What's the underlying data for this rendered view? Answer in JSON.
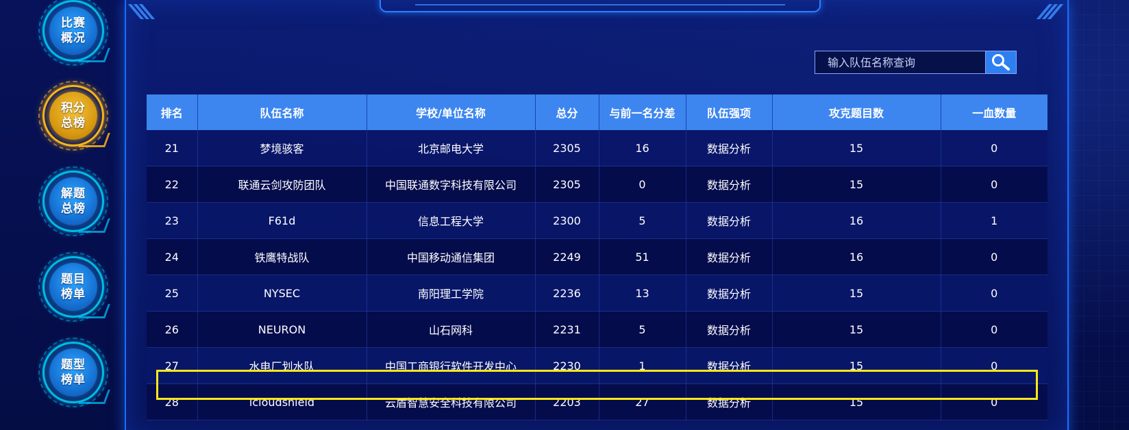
{
  "sidebar": {
    "items": [
      {
        "label": "比赛概况",
        "active": false
      },
      {
        "label": "积分总榜",
        "active": true
      },
      {
        "label": "解题总榜",
        "active": false
      },
      {
        "label": "题目榜单",
        "active": false
      },
      {
        "label": "题型榜单",
        "active": false
      }
    ]
  },
  "search": {
    "placeholder": "输入队伍名称查询",
    "value": "",
    "button_icon": "search-icon"
  },
  "table": {
    "columns": [
      "排名",
      "队伍名称",
      "学校/单位名称",
      "总分",
      "与前一名分差",
      "队伍强项",
      "攻克题目数",
      "一血数量"
    ],
    "rows": [
      [
        "21",
        "梦境骇客",
        "北京邮电大学",
        "2305",
        "16",
        "数据分析",
        "15",
        "0"
      ],
      [
        "22",
        "联通云剑攻防团队",
        "中国联通数字科技有限公司",
        "2305",
        "0",
        "数据分析",
        "15",
        "0"
      ],
      [
        "23",
        "F61d",
        "信息工程大学",
        "2300",
        "5",
        "数据分析",
        "16",
        "1"
      ],
      [
        "24",
        "铁鹰特战队",
        "中国移动通信集团",
        "2249",
        "51",
        "数据分析",
        "16",
        "0"
      ],
      [
        "25",
        "NYSEC",
        "南阳理工学院",
        "2236",
        "13",
        "数据分析",
        "15",
        "0"
      ],
      [
        "26",
        "NEURON",
        "山石网科",
        "2231",
        "5",
        "数据分析",
        "15",
        "0"
      ],
      [
        "27",
        "水电厂划水队",
        "中国工商银行软件开发中心",
        "2230",
        "1",
        "数据分析",
        "15",
        "0"
      ],
      [
        "28",
        "icloudshield",
        "云盾智慧安全科技有限公司",
        "2203",
        "27",
        "数据分析",
        "15",
        "0"
      ]
    ],
    "highlighted_rank": "25"
  },
  "colors": {
    "accent": "#3d86f0",
    "highlight": "#ffe81a",
    "active_nav": "#f2c23a"
  }
}
